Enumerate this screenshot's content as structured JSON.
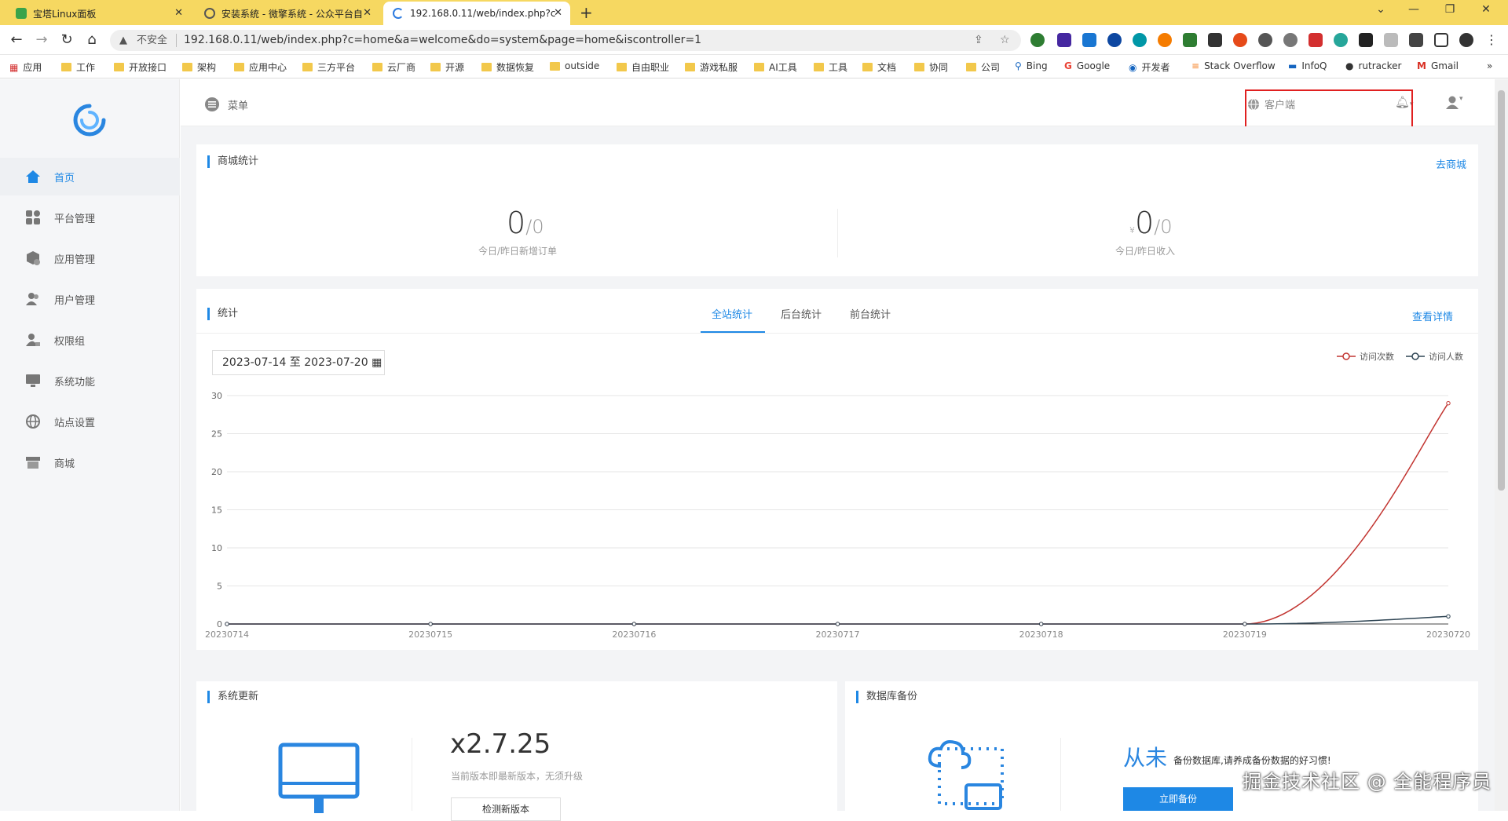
{
  "browser": {
    "tabs": [
      {
        "title": "宝塔Linux面板"
      },
      {
        "title": "安装系统 - 微擎系统 - 公众平台自"
      },
      {
        "title": "192.168.0.11/web/index.php?c"
      }
    ],
    "new_tab": "+",
    "security_label": "不安全",
    "url": "192.168.0.11/web/index.php?c=home&a=welcome&do=system&page=home&iscontroller=1",
    "bookmarks": [
      "应用",
      "工作",
      "开放接口",
      "架构",
      "应用中心",
      "三方平台",
      "云厂商",
      "开源",
      "数据恢复",
      "outside",
      "自由职业",
      "游戏私服",
      "AI工具",
      "工具",
      "文档",
      "协同",
      "公司",
      "Bing",
      "Google",
      "开发者",
      "Stack Overflow",
      "InfoQ",
      "rutracker",
      "Gmail"
    ]
  },
  "topbar": {
    "menu_label": "菜单",
    "client_label": "客户端"
  },
  "sidebar": {
    "items": [
      {
        "label": "首页",
        "icon": "home-icon"
      },
      {
        "label": "平台管理",
        "icon": "grid-icon"
      },
      {
        "label": "应用管理",
        "icon": "apps-icon"
      },
      {
        "label": "用户管理",
        "icon": "users-icon"
      },
      {
        "label": "权限组",
        "icon": "lock-user-icon"
      },
      {
        "label": "系统功能",
        "icon": "monitor-icon"
      },
      {
        "label": "站点设置",
        "icon": "globe-icon"
      },
      {
        "label": "商城",
        "icon": "store-icon"
      }
    ]
  },
  "shop_stats": {
    "title": "商城统计",
    "link": "去商城",
    "orders_today": "0",
    "orders_yesterday": "/0",
    "orders_label": "今日/昨日新增订单",
    "currency": "¥",
    "income_today": "0",
    "income_yesterday": "/0",
    "income_label": "今日/昨日收入"
  },
  "stats": {
    "title": "统计",
    "tabs": [
      "全站统计",
      "后台统计",
      "前台统计"
    ],
    "active_tab": 0,
    "detail_link": "查看详情",
    "date_range": "2023-07-14 至 2023-07-20"
  },
  "chart_data": {
    "type": "line",
    "x": [
      "20230714",
      "20230715",
      "20230716",
      "20230717",
      "20230718",
      "20230719",
      "20230720"
    ],
    "series": [
      {
        "name": "访问次数",
        "color": "#c23531",
        "values": [
          0,
          0,
          0,
          0,
          0,
          0,
          29
        ]
      },
      {
        "name": "访问人数",
        "color": "#2f4554",
        "values": [
          0,
          0,
          0,
          0,
          0,
          0,
          1
        ]
      }
    ],
    "ylim": [
      0,
      30
    ],
    "yticks": [
      0,
      5,
      10,
      15,
      20,
      25,
      30
    ],
    "grid": true,
    "legend_position": "top-right"
  },
  "system_update": {
    "title": "系统更新",
    "version": "x2.7.25",
    "note": "当前版本即最新版本，无须升级",
    "check_button": "检测新版本"
  },
  "db_backup": {
    "title": "数据库备份",
    "status": "从未",
    "note": "备份数据库,请养成备份数据的好习惯!",
    "backup_button": "立即备份"
  },
  "watermark": "掘金技术社区 @ 全能程序员"
}
